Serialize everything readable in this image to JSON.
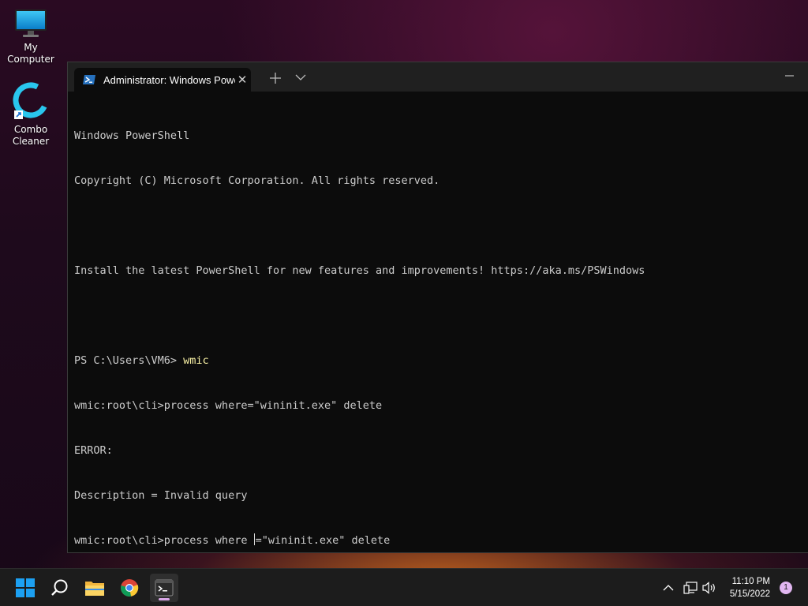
{
  "desktop": {
    "icons": [
      {
        "label": "My Computer"
      },
      {
        "label": "Combo\nCleaner"
      }
    ]
  },
  "terminal": {
    "tab_title": "Administrator: Windows PowerS",
    "lines": [
      {
        "text": "Windows PowerShell"
      },
      {
        "text": "Copyright (C) Microsoft Corporation. All rights reserved."
      },
      {
        "text": ""
      },
      {
        "text": "Install the latest PowerShell for new features and improvements! https://aka.ms/PSWindows"
      },
      {
        "text": ""
      },
      {
        "prompt": "PS C:\\Users\\VM6> ",
        "cmd": "wmic"
      },
      {
        "text": "wmic:root\\cli>process where=\"wininit.exe\" delete"
      },
      {
        "text": "ERROR:"
      },
      {
        "text": "Description = Invalid query"
      },
      {
        "before_cursor": "wmic:root\\cli>process where ",
        "after_cursor": "=\"wininit.exe\" delete"
      }
    ]
  },
  "taskbar": {
    "apps": [
      "start-icon",
      "search-icon",
      "file-explorer-icon",
      "chrome-icon",
      "terminal-icon"
    ],
    "time": "11:10 PM",
    "date": "5/15/2022",
    "notification_count": "1"
  },
  "colors": {
    "terminal_bg": "#0c0c0c",
    "terminal_text": "#cccccc",
    "command_text": "#f9f1a5",
    "accent": "#d9a7e8"
  }
}
